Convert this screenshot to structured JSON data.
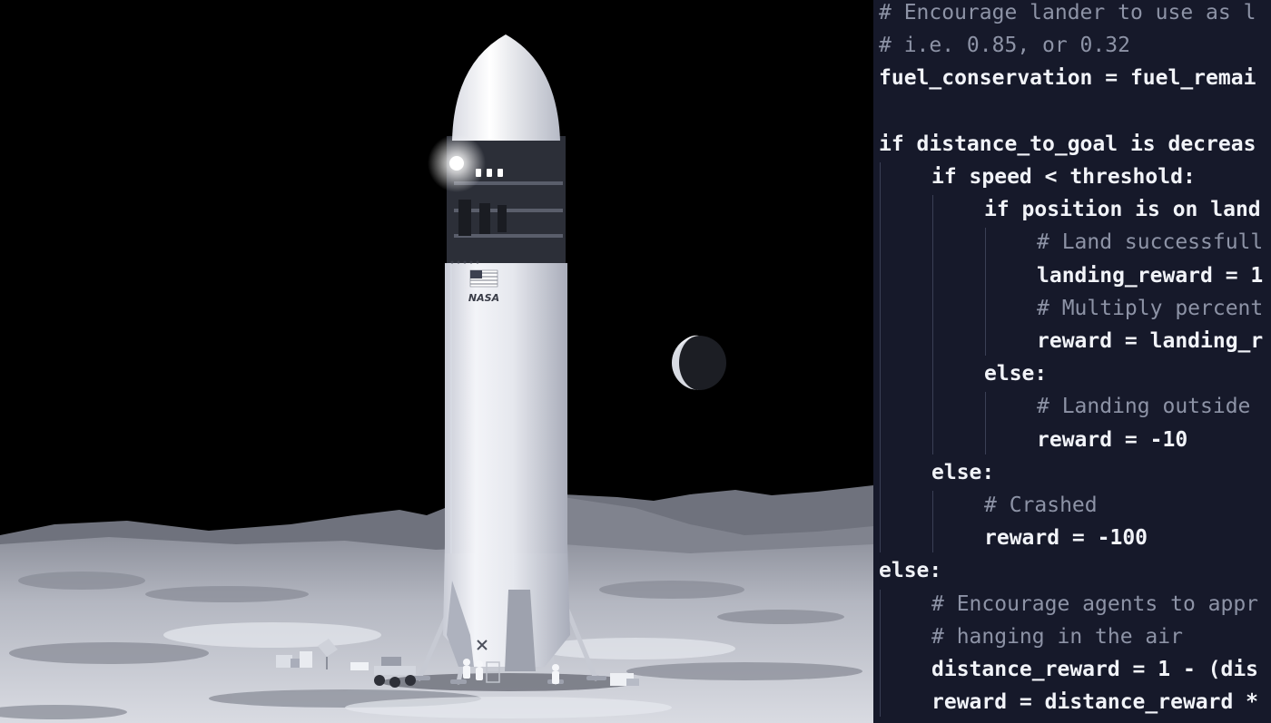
{
  "illustration": {
    "insignia_text": "NASA",
    "colors": {
      "sky": "#000000",
      "surface": "#b9bbc4",
      "hull": "#eceef3",
      "code_bg": "#16192a"
    }
  },
  "code_panel": {
    "lines": [
      {
        "text": "# Encourage lander to use as l",
        "indent": 0,
        "kind": "comment"
      },
      {
        "text": "# i.e. 0.85, or 0.32",
        "indent": 0,
        "kind": "comment"
      },
      {
        "text": "fuel_conservation = fuel_remai",
        "indent": 0,
        "kind": "code"
      },
      {
        "text": "",
        "indent": 0,
        "kind": "blank"
      },
      {
        "text": "if distance_to_goal is decreas",
        "indent": 0,
        "kind": "code"
      },
      {
        "text": "if speed < threshold:",
        "indent": 1,
        "kind": "code"
      },
      {
        "text": "if position is on land",
        "indent": 2,
        "kind": "code"
      },
      {
        "text": "# Land successfull",
        "indent": 3,
        "kind": "comment"
      },
      {
        "text": "landing_reward = 1",
        "indent": 3,
        "kind": "code"
      },
      {
        "text": "# Multiply percent",
        "indent": 3,
        "kind": "comment"
      },
      {
        "text": "reward = landing_r",
        "indent": 3,
        "kind": "code"
      },
      {
        "text": "else:",
        "indent": 2,
        "kind": "code"
      },
      {
        "text": "# Landing outside",
        "indent": 3,
        "kind": "comment"
      },
      {
        "text": "reward = -10",
        "indent": 3,
        "kind": "code"
      },
      {
        "text": "else:",
        "indent": 1,
        "kind": "code"
      },
      {
        "text": "# Crashed",
        "indent": 2,
        "kind": "comment"
      },
      {
        "text": "reward = -100",
        "indent": 2,
        "kind": "code"
      },
      {
        "text": "else:",
        "indent": 0,
        "kind": "code"
      },
      {
        "text": "# Encourage agents to appr",
        "indent": 1,
        "kind": "comment"
      },
      {
        "text": "# hanging in the air",
        "indent": 1,
        "kind": "comment"
      },
      {
        "text": "distance_reward = 1 - (dis",
        "indent": 1,
        "kind": "code"
      },
      {
        "text": "reward = distance_reward *",
        "indent": 1,
        "kind": "code"
      }
    ]
  }
}
